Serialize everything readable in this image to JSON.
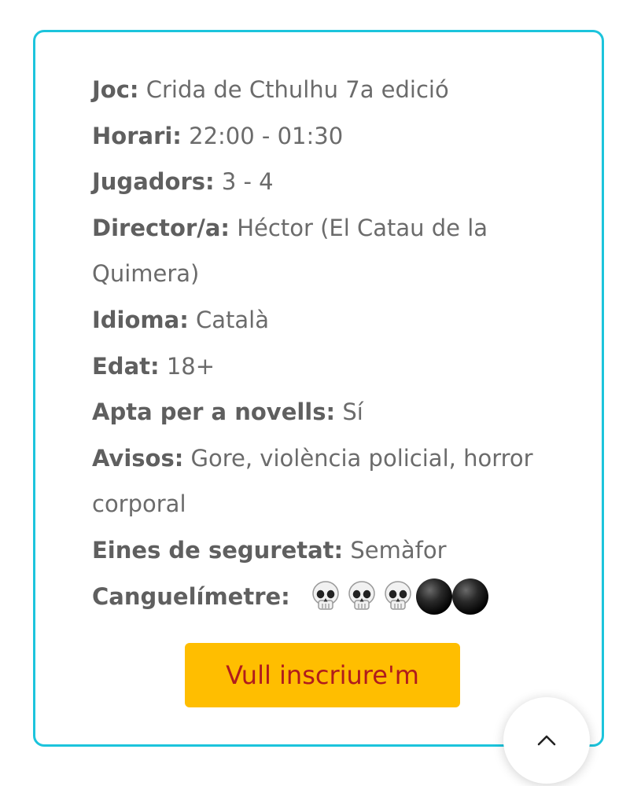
{
  "event_info": {
    "rows": [
      {
        "key": "Joc:",
        "value": " Crida de Cthulhu 7a edició"
      },
      {
        "key": "Horari:",
        "value": " 22:00 - 01:30"
      },
      {
        "key": "Jugadors:",
        "value": " 3 - 4"
      },
      {
        "key": "Director/a:",
        "value": " Héctor (El Catau de la Quimera)"
      },
      {
        "key": "Idioma:",
        "value": " Català"
      },
      {
        "key": "Edat:",
        "value": " 18+"
      },
      {
        "key": "Apta per a novells:",
        "value": " Sí"
      },
      {
        "key": "Avisos:",
        "value": " Gore, violència policial, horror corporal"
      },
      {
        "key": "Eines de seguretat:",
        "value": " Semàfor"
      }
    ],
    "gauge": {
      "label": "Canguelímetre:",
      "level": 3,
      "max": 5,
      "filled_icon": "skull-icon",
      "empty_icon": "black-circle-icon"
    }
  },
  "cta": {
    "label": "Vull inscriure'm",
    "background": "#ffbe00",
    "text_color": "#b01c1c"
  },
  "scroll_top": {
    "icon": "chevron-up-icon"
  },
  "colors": {
    "card_border": "#1cc4dc",
    "text": "#6b6b6b"
  }
}
